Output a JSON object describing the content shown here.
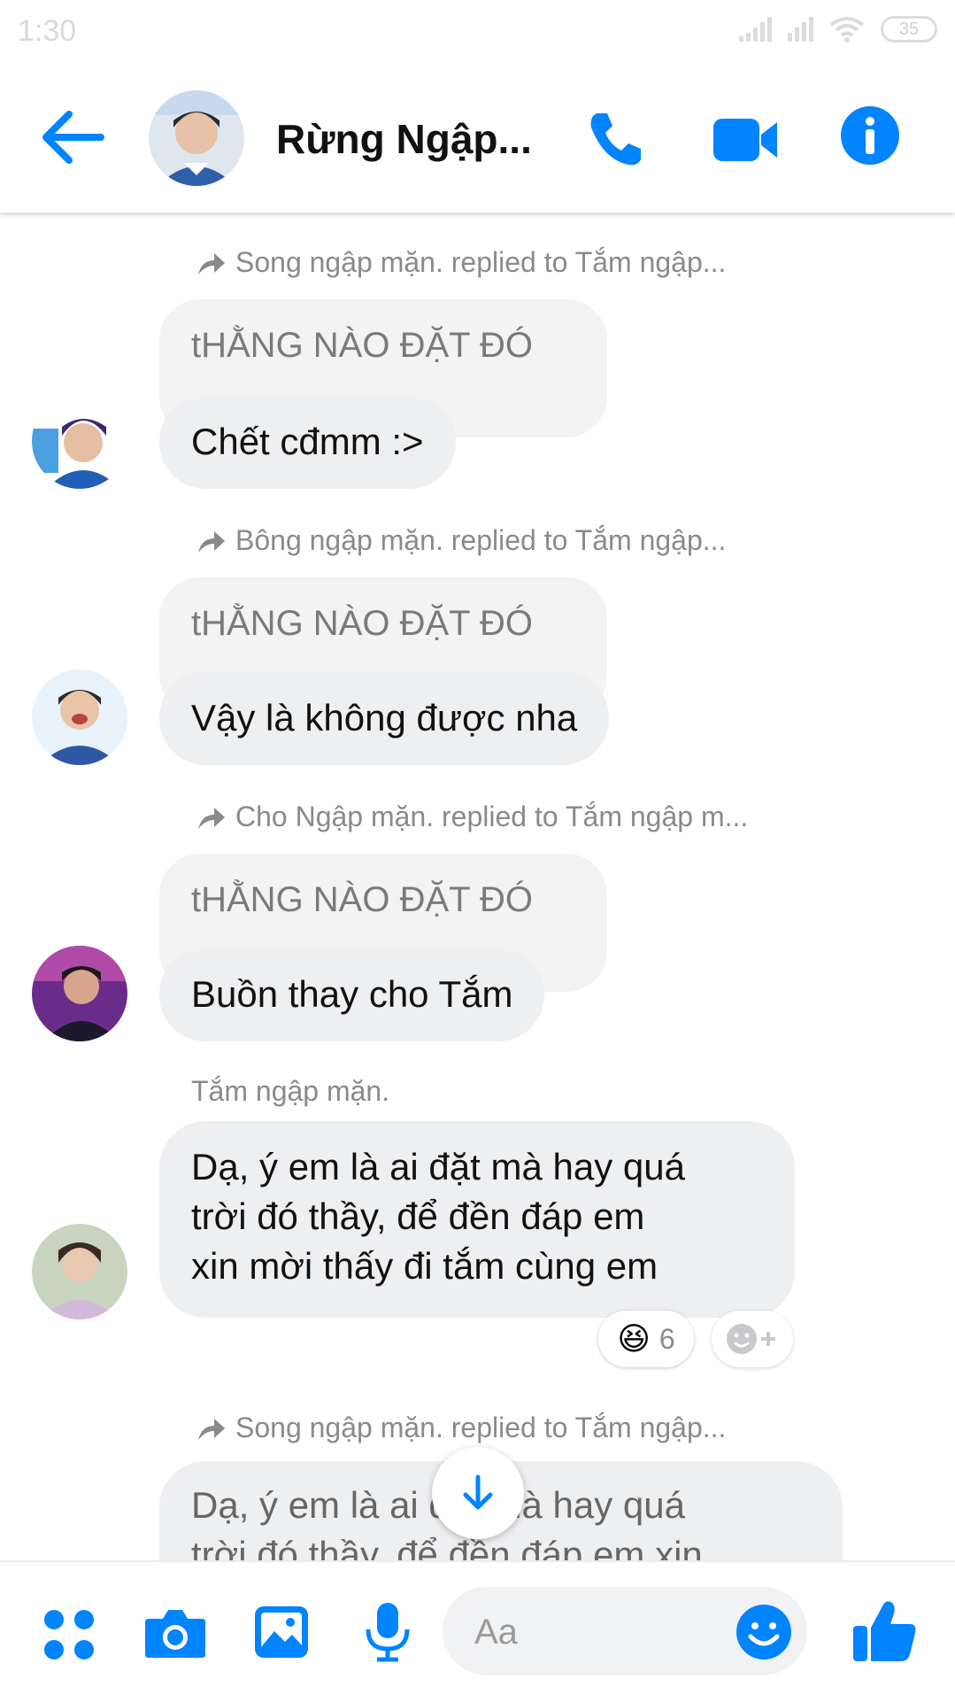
{
  "status_bar": {
    "time": "1:30",
    "battery": "35"
  },
  "header": {
    "title": "Rừng Ngập..."
  },
  "colors": {
    "accent": "#0084ff",
    "bubble": "#eeeff1",
    "quoted": "#f3f3f4",
    "meta_text": "#8a8a8a"
  },
  "messages": [
    {
      "reply_note": "Song ngập mặn. replied to Tắm ngập...",
      "quoted": "tHẰNG NÀO ĐẶT ĐÓ",
      "text": "Chết cđmm :>"
    },
    {
      "reply_note": "Bông ngập mặn. replied to Tắm ngập...",
      "quoted": "tHẰNG NÀO ĐẶT ĐÓ",
      "text": "Vậy là không được nha"
    },
    {
      "reply_note": "Cho Ngập mặn. replied to Tắm ngập m...",
      "quoted": "tHẰNG NÀO ĐẶT ĐÓ",
      "text": "Buồn thay cho Tắm"
    }
  ],
  "tam_message": {
    "sender": "Tắm ngập mặn.",
    "lines": [
      "Dạ, ý em là ai đặt mà hay quá",
      "trời đó thầy, để đền đáp em",
      "xin mời thấy đi tắm cùng em"
    ],
    "reaction_emoji": "😆",
    "reaction_count": "6"
  },
  "last_reply": {
    "reply_note": "Song ngập mặn. replied to Tắm ngập...",
    "lines": [
      "Dạ, ý em là ai đặt mà hay quá",
      "trời đó thầy, để đền đáp em xin"
    ]
  },
  "composer": {
    "placeholder": "Aa"
  },
  "icons": [
    "back-arrow-icon",
    "phone-icon",
    "video-camera-icon",
    "info-icon",
    "reply-arrow-icon",
    "arrow-down-icon",
    "menu-dots-icon",
    "camera-icon",
    "image-icon",
    "microphone-icon",
    "emoji-icon",
    "thumbs-up-icon",
    "add-reaction-icon"
  ]
}
